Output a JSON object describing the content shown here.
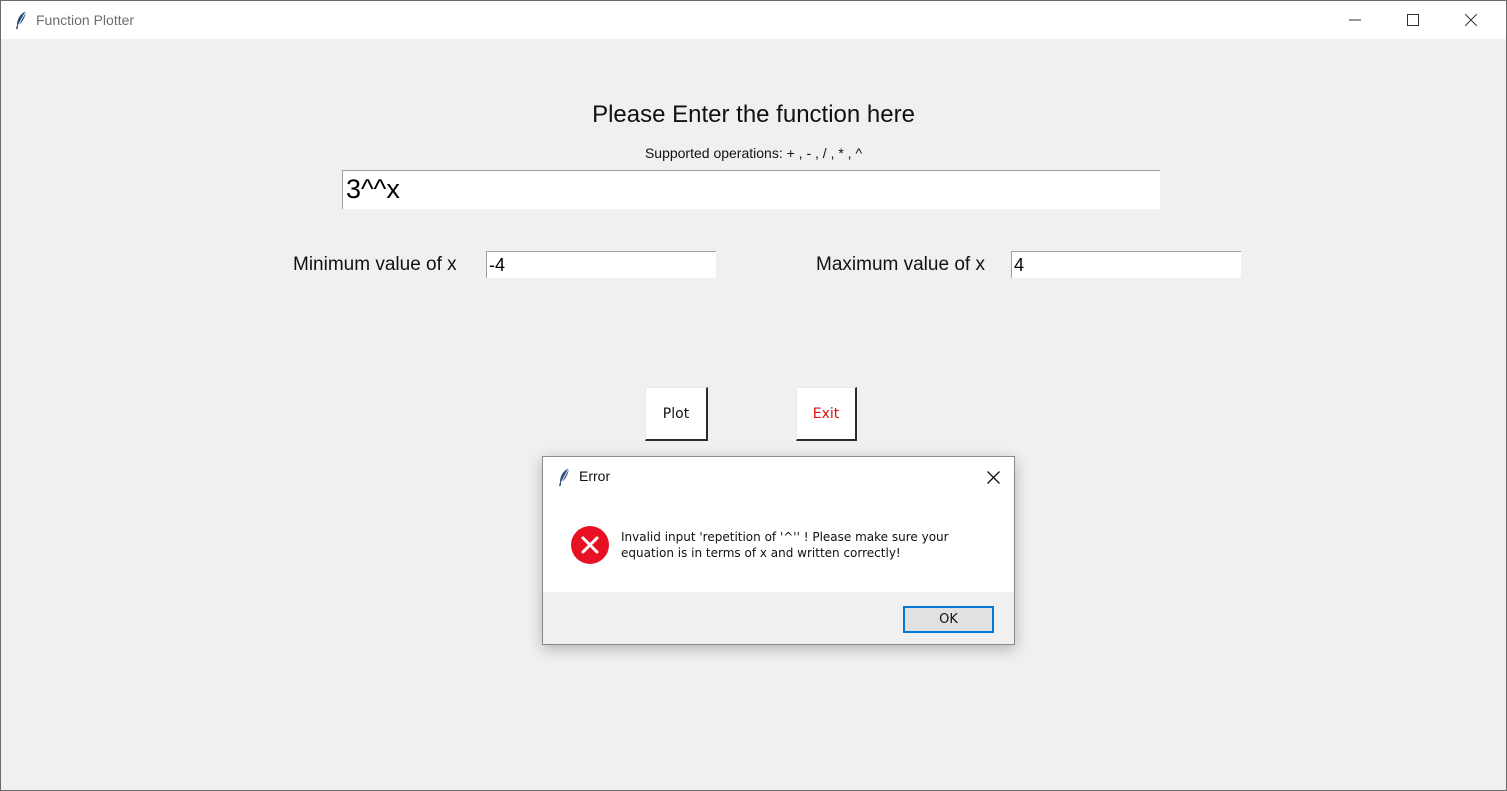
{
  "window": {
    "title": "Function Plotter",
    "controls": {
      "minimize": "minimize-icon",
      "maximize": "maximize-icon",
      "close": "close-icon"
    }
  },
  "main": {
    "heading": "Please Enter the function here",
    "subheading": "Supported operations: + , - , / , * , ^",
    "function_value": "3^^x",
    "min_label": "Minimum value of x",
    "min_value": "-4",
    "max_label": "Maximum value of x",
    "max_value": "4",
    "plot_label": "Plot",
    "exit_label": "Exit"
  },
  "dialog": {
    "title": "Error",
    "message_line1": "Invalid input 'repetition of '^'' ! Please make sure your",
    "message_line2": "equation is in terms of x and written correctly!",
    "ok_label": "OK",
    "icon": "error-icon"
  },
  "colors": {
    "window_bg": "#f0f0f0",
    "exit_text": "#e01010",
    "error_icon": "#e81123",
    "ok_border": "#0078d7"
  }
}
